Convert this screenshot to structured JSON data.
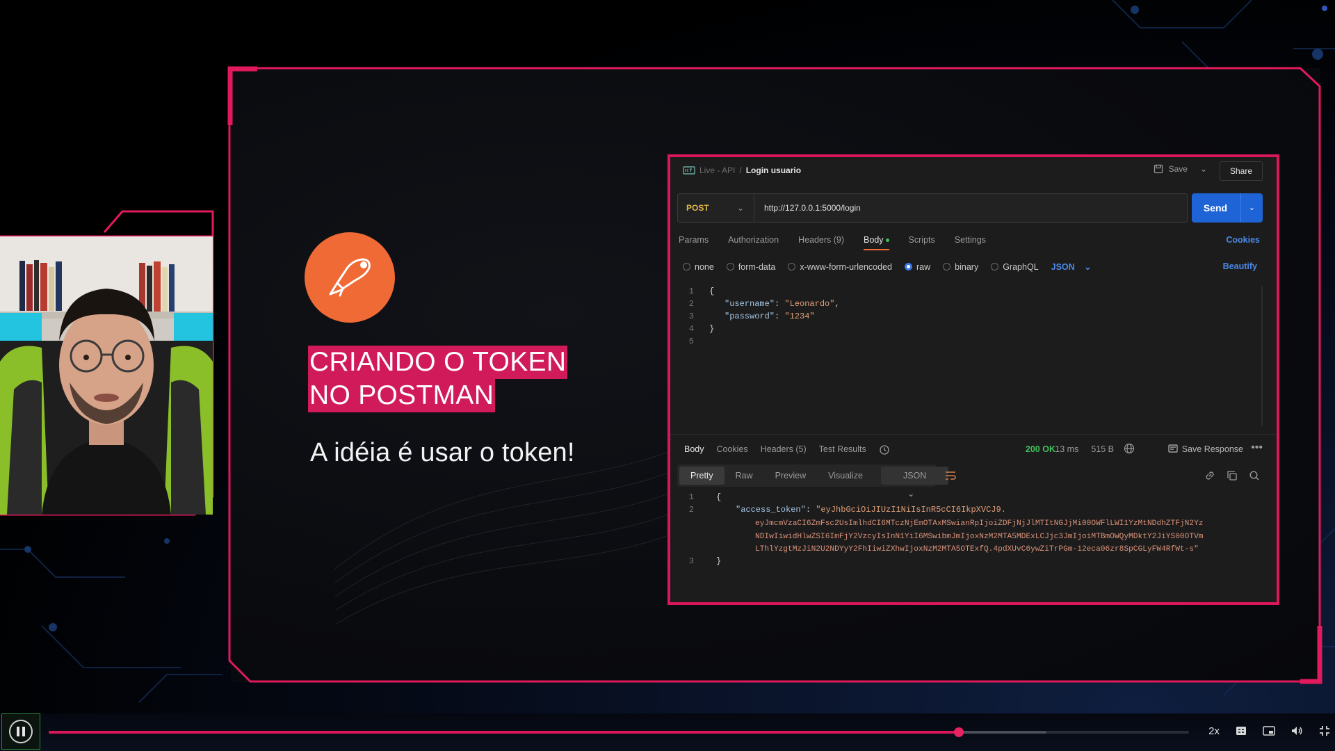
{
  "slide": {
    "headline_line1": "CRIANDO O TOKEN",
    "headline_line2": "NO POSTMAN",
    "subtitle": "A idéia é usar o token!"
  },
  "postman": {
    "breadcrumb": [
      "Live - API",
      "/",
      "Login usuario"
    ],
    "save_label": "Save",
    "share_label": "Share",
    "method": "POST",
    "url": "http://127.0.0.1:5000/login",
    "send_label": "Send",
    "request_tabs": [
      {
        "label": "Params"
      },
      {
        "label": "Authorization"
      },
      {
        "label": "Headers (9)"
      },
      {
        "label": "Body",
        "active": true
      },
      {
        "label": "Scripts"
      },
      {
        "label": "Settings"
      }
    ],
    "cookies_label": "Cookies",
    "body_types": [
      {
        "label": "none",
        "selected": false
      },
      {
        "label": "form-data",
        "selected": false
      },
      {
        "label": "x-www-form-urlencoded",
        "selected": false
      },
      {
        "label": "raw",
        "selected": true
      },
      {
        "label": "binary",
        "selected": false
      },
      {
        "label": "GraphQL",
        "selected": false
      }
    ],
    "body_format": "JSON",
    "beautify_label": "Beautify",
    "request_body_lines": [
      {
        "n": "1",
        "text": "{"
      },
      {
        "n": "2",
        "key": "\"username\"",
        "value": "\"Leonardo\"",
        "trail": ","
      },
      {
        "n": "3",
        "key": "\"password\"",
        "value": "\"1234\"",
        "trail": ""
      },
      {
        "n": "4",
        "text": "}"
      },
      {
        "n": "5",
        "text": ""
      }
    ],
    "response_tabs": [
      {
        "label": "Body",
        "active": true
      },
      {
        "label": "Cookies"
      },
      {
        "label": "Headers (5)"
      },
      {
        "label": "Test Results"
      }
    ],
    "status": "200 OK",
    "time": "13 ms",
    "size": "515 B",
    "save_response_label": "Save Response",
    "view_modes": [
      "Pretty",
      "Raw",
      "Preview",
      "Visualize"
    ],
    "response_format": "JSON",
    "response_key": "\"access_token\"",
    "token_lines": [
      "\"eyJhbGciOiJIUzI1NiIsInR5cCI6IkpXVCJ9.",
      "eyJmcmVzaCI6ZmFsc2UsImlhdCI6MTczNjEmOTAxMSwianRpIjoiZDFjNjJlMTItNGJjMi00OWFlLWI1YzMtNDdhZTFjN2Yz",
      "NDIwIiwidHlwZSI6ImFjY2VzcyIsInN1YiI6MSwibmJmIjoxNzM2MTA5MDExLCJjc3JmIjoiMTBmOWQyMDktY2JiYS00OTVm",
      "LThlYzgtMzJiN2U2NDYyY2FhIiwiZXhwIjoxNzM2MTA5OTExfQ.4pdXUvC6ywZiTrPGm-12eca06zr8SpCGLyFW4RfWt-s\""
    ],
    "response_line_numbers": [
      "1",
      "2",
      "3"
    ]
  },
  "player": {
    "progress": 0.798,
    "buffered": 0.875,
    "speed_label": "2x"
  },
  "colors": {
    "accent": "#d9175a",
    "postman_orange": "#ef6a35",
    "send_blue": "#1f64d6",
    "ok_green": "#3fbf5a"
  }
}
